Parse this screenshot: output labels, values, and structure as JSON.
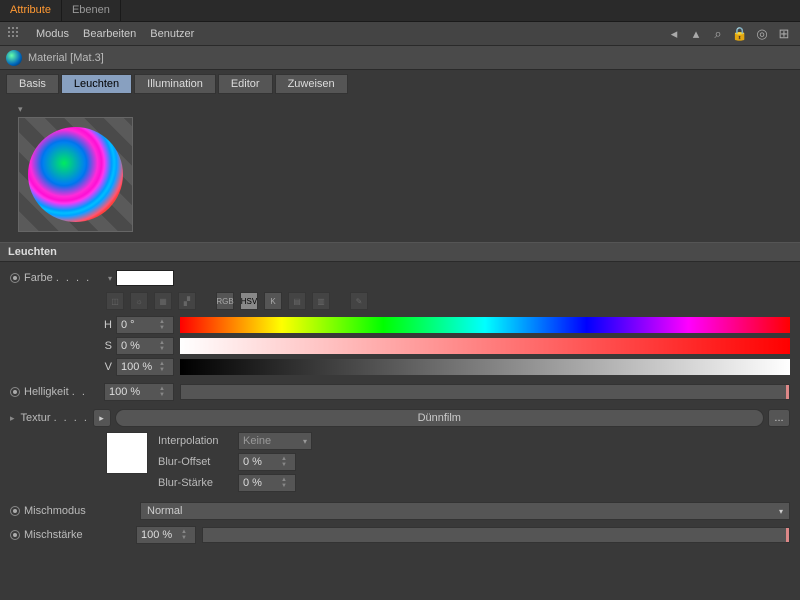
{
  "topTabs": {
    "attribute": "Attribute",
    "ebenen": "Ebenen"
  },
  "menubar": {
    "modus": "Modus",
    "bearbeiten": "Bearbeiten",
    "benutzer": "Benutzer"
  },
  "header": {
    "title": "Material [Mat.3]"
  },
  "channelTabs": {
    "basis": "Basis",
    "leuchten": "Leuchten",
    "illumination": "Illumination",
    "editor": "Editor",
    "zuweisen": "Zuweisen"
  },
  "section": "Leuchten",
  "farbe": {
    "label": "Farbe",
    "modes": {
      "rgb": "RGB",
      "hsv": "HSV",
      "k": "K"
    },
    "h": {
      "label": "H",
      "value": "0 °"
    },
    "s": {
      "label": "S",
      "value": "0 %"
    },
    "v": {
      "label": "V",
      "value": "100 %"
    }
  },
  "helligkeit": {
    "label": "Helligkeit",
    "value": "100 %"
  },
  "textur": {
    "label": "Textur",
    "value": "Dünnfilm",
    "dots": "...",
    "interpolation": {
      "label": "Interpolation",
      "value": "Keine"
    },
    "blurOffset": {
      "label": "Blur-Offset",
      "value": "0 %"
    },
    "blurStaerke": {
      "label": "Blur-Stärke",
      "value": "0 %"
    }
  },
  "mischmodus": {
    "label": "Mischmodus",
    "value": "Normal"
  },
  "mischstaerke": {
    "label": "Mischstärke",
    "value": "100 %"
  }
}
